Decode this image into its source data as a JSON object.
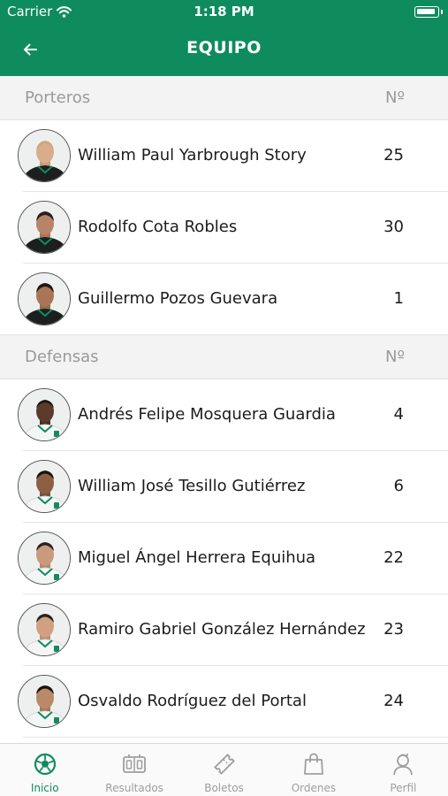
{
  "status_bar": {
    "carrier": "Carrier",
    "time": "1:18 PM"
  },
  "header": {
    "title": "EQUIPO",
    "back_icon": "arrow-left-icon"
  },
  "sections": [
    {
      "title": "Porteros",
      "number_header": "Nº",
      "players": [
        {
          "name": "William Paul Yarbrough Story",
          "number": "25"
        },
        {
          "name": "Rodolfo Cota Robles",
          "number": "30"
        },
        {
          "name": "Guillermo Pozos Guevara",
          "number": "1"
        }
      ]
    },
    {
      "title": "Defensas",
      "number_header": "Nº",
      "players": [
        {
          "name": "Andrés Felipe Mosquera Guardia",
          "number": "4"
        },
        {
          "name": "William José Tesillo Gutiérrez",
          "number": "6"
        },
        {
          "name": "Miguel Ángel Herrera Equihua",
          "number": "22"
        },
        {
          "name": "Ramiro Gabriel González Hernández",
          "number": "23"
        },
        {
          "name": "Osvaldo Rodríguez del Portal",
          "number": "24"
        }
      ]
    }
  ],
  "tabs": [
    {
      "label": "Inicio",
      "icon": "soccer-ball-icon",
      "active": true
    },
    {
      "label": "Resultados",
      "icon": "scoreboard-icon",
      "active": false
    },
    {
      "label": "Boletos",
      "icon": "ticket-icon",
      "active": false
    },
    {
      "label": "Ordenes",
      "icon": "shopping-bag-icon",
      "active": false
    },
    {
      "label": "Perfil",
      "icon": "user-profile-icon",
      "active": false
    }
  ],
  "colors": {
    "primary": "#0f8c5e",
    "inactive": "#9e9e9e",
    "section_bg": "#f3f3f3"
  }
}
